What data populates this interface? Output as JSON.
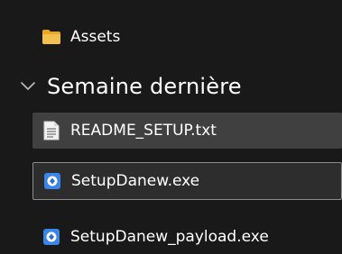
{
  "folders": [
    {
      "label": "Assets",
      "icon": "folder-icon"
    }
  ],
  "group": {
    "title": "Semaine dernière",
    "expanded": true
  },
  "files": [
    {
      "label": "README_SETUP.txt",
      "icon": "text-file-icon",
      "state": "hovered"
    },
    {
      "label": "SetupDanew.exe",
      "icon": "exe-app-icon",
      "state": "selected"
    },
    {
      "label": "SetupDanew_payload.exe",
      "icon": "exe-app-icon",
      "state": "normal"
    }
  ],
  "colors": {
    "background": "#191919",
    "hover": "#404040",
    "selected_bg": "#2d2d2d",
    "selected_border": "#8a8a8a",
    "folder": "#f4c14f",
    "exe_icon": "#3a86e8"
  }
}
